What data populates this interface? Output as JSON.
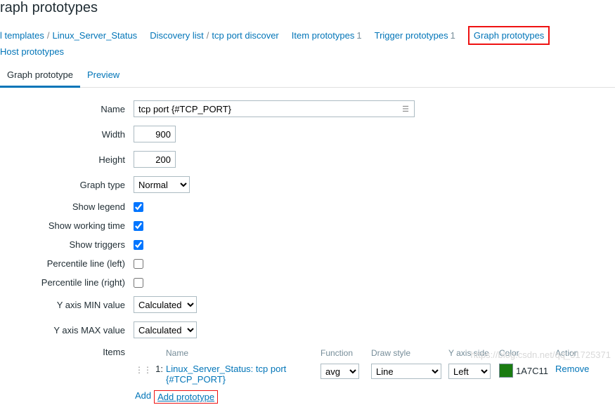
{
  "page_title": "raph prototypes",
  "breadcrumbs": {
    "all_templates": "l templates",
    "template_name": "Linux_Server_Status",
    "discovery_list": "Discovery list",
    "rule_name": "tcp port discover",
    "item_proto": "Item prototypes",
    "item_proto_count": "1",
    "trigger_proto": "Trigger prototypes",
    "trigger_proto_count": "1",
    "graph_proto": "Graph prototypes",
    "host_proto": "Host prototypes"
  },
  "tabs": {
    "graph": "Graph prototype",
    "preview": "Preview"
  },
  "form": {
    "labels": {
      "name": "Name",
      "width": "Width",
      "height": "Height",
      "graph_type": "Graph type",
      "show_legend": "Show legend",
      "show_working": "Show working time",
      "show_triggers": "Show triggers",
      "perc_left": "Percentile line (left)",
      "perc_right": "Percentile line (right)",
      "y_min": "Y axis MIN value",
      "y_max": "Y axis MAX value",
      "items": "Items"
    },
    "values": {
      "name": "tcp port {#TCP_PORT}",
      "width": "900",
      "height": "200",
      "graph_type": "Normal",
      "show_legend": true,
      "show_working": true,
      "show_triggers": true,
      "perc_left": false,
      "perc_right": false,
      "y_min": "Calculated",
      "y_max": "Calculated"
    }
  },
  "items_table": {
    "headers": {
      "name": "Name",
      "function": "Function",
      "draw_style": "Draw style",
      "y_axis_side": "Y axis side",
      "color": "Color",
      "action": "Action"
    },
    "rows": [
      {
        "num": "1:",
        "name": "Linux_Server_Status: tcp port {#TCP_PORT}",
        "function": "avg",
        "draw_style": "Line",
        "y_axis_side": "Left",
        "color": "1A7C11",
        "color_hex": "#1A7C11",
        "action": "Remove"
      }
    ],
    "footer": {
      "add": "Add",
      "add_prototype": "Add prototype"
    }
  },
  "watermark": "https://blog.csdn.net/qq_31725371"
}
